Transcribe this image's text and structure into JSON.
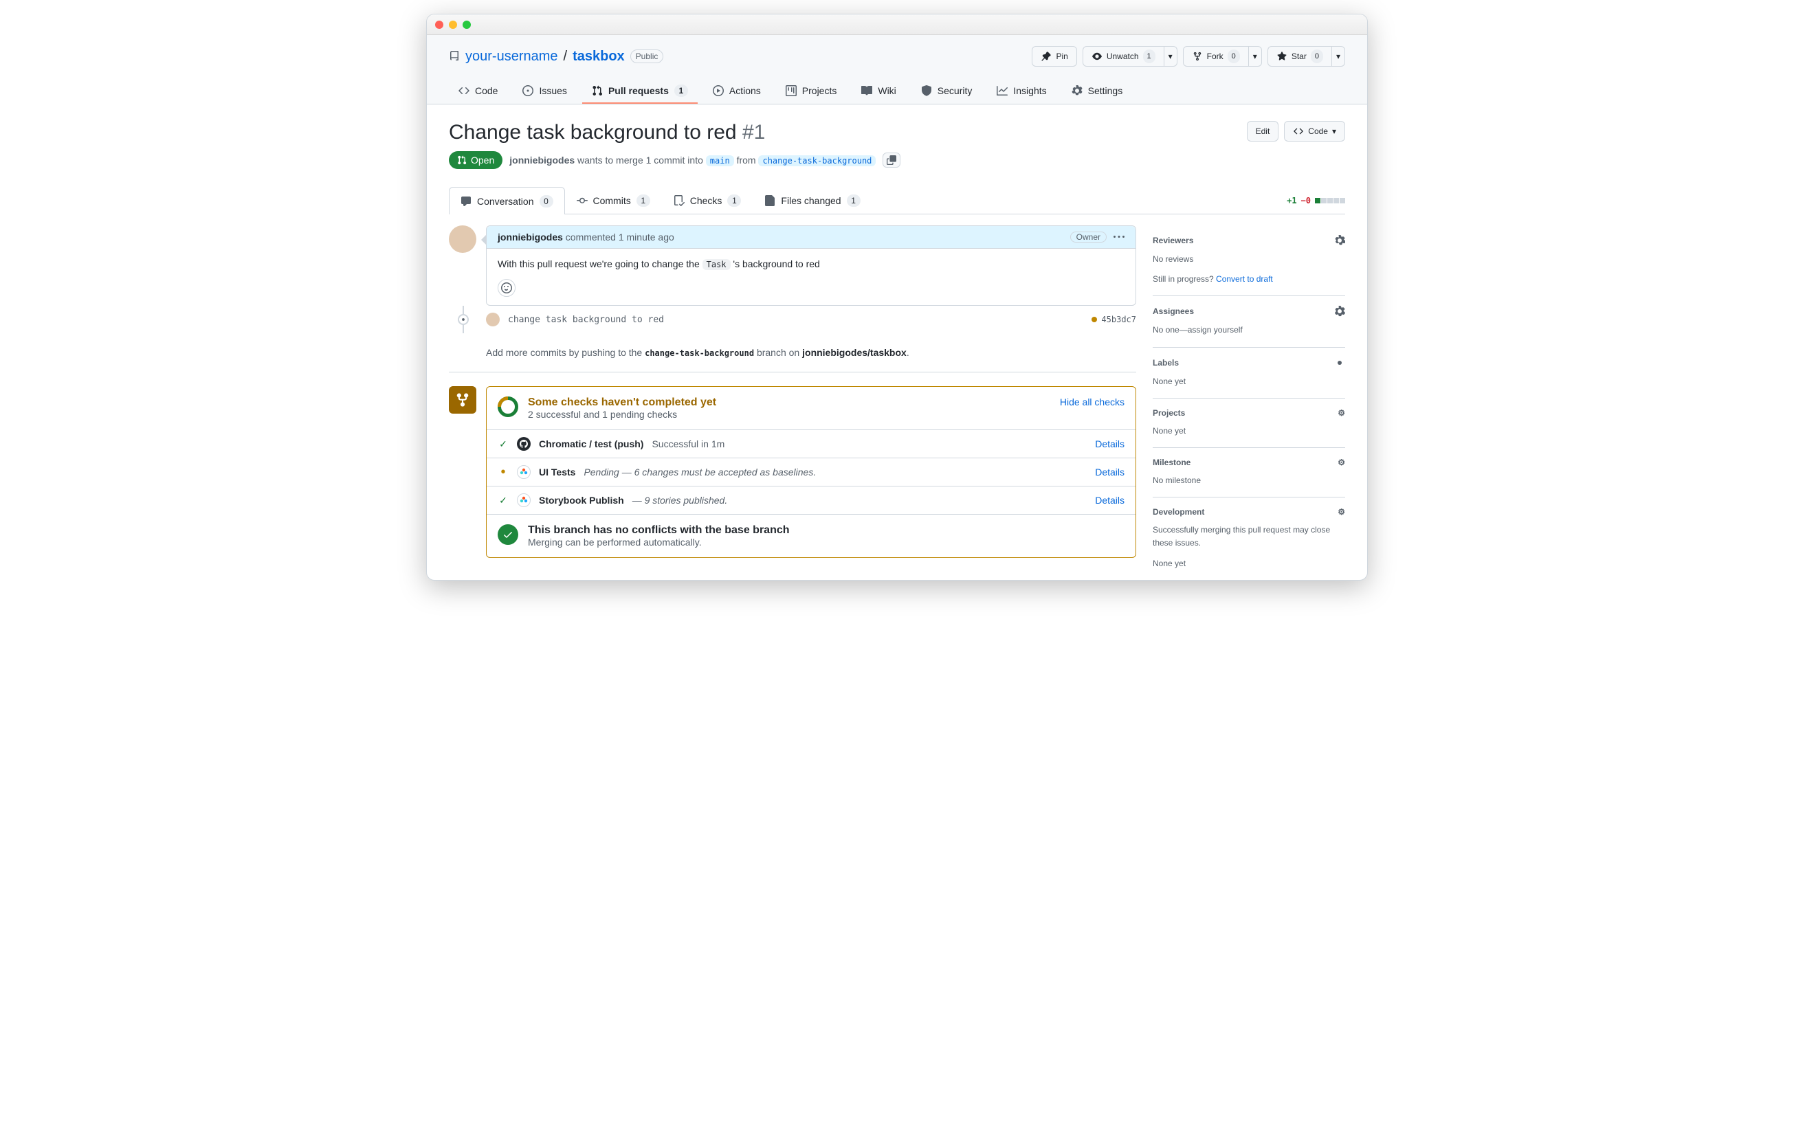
{
  "repo": {
    "owner": "your-username",
    "name": "taskbox",
    "visibility": "Public"
  },
  "header_actions": {
    "pin": "Pin",
    "unwatch": "Unwatch",
    "unwatch_count": "1",
    "fork": "Fork",
    "fork_count": "0",
    "star": "Star",
    "star_count": "0"
  },
  "nav": {
    "code": "Code",
    "issues": "Issues",
    "pulls": "Pull requests",
    "pulls_count": "1",
    "actions": "Actions",
    "projects": "Projects",
    "wiki": "Wiki",
    "security": "Security",
    "insights": "Insights",
    "settings": "Settings"
  },
  "pr": {
    "title": "Change task background to red",
    "number": "#1",
    "state": "Open",
    "author": "jonniebigodes",
    "wants_merge": " wants to merge 1 commit into ",
    "base": "main",
    "from_word": " from ",
    "head": "change-task-background",
    "edit_btn": "Edit",
    "code_btn": "Code"
  },
  "pr_tabs": {
    "conversation": "Conversation",
    "conversation_count": "0",
    "commits": "Commits",
    "commits_count": "1",
    "checks": "Checks",
    "checks_count": "1",
    "files": "Files changed",
    "files_count": "1",
    "diff_add": "+1",
    "diff_del": "−0"
  },
  "comment": {
    "author": "jonniebigodes",
    "action": " commented ",
    "time": "1 minute ago",
    "owner": "Owner",
    "body_pre": "With this pull request we're going to change the ",
    "body_code": "Task",
    "body_post": " 's background to red"
  },
  "commit": {
    "message": "change task background to red",
    "sha": "45b3dc7"
  },
  "push_hint": {
    "pre": "Add more commits by pushing to the ",
    "branch": "change-task-background",
    "mid": " branch on ",
    "repo": "jonniebigodes/taskbox",
    "post": "."
  },
  "checks": {
    "title": "Some checks haven't completed yet",
    "subtitle": "2 successful and 1 pending checks",
    "hide": "Hide all checks",
    "details": "Details",
    "rows": [
      {
        "name": "Chromatic / test (push)",
        "desc": "Successful in 1m",
        "status": "ok",
        "italic": false,
        "app": "gh"
      },
      {
        "name": "UI Tests",
        "desc": "Pending — 6 changes must be accepted as baselines.",
        "status": "pend",
        "italic": true,
        "app": "chr"
      },
      {
        "name": "Storybook Publish",
        "desc": "— 9 stories published.",
        "status": "ok",
        "italic": true,
        "app": "chr"
      }
    ],
    "merge_title": "This branch has no conflicts with the base branch",
    "merge_sub": "Merging can be performed automatically."
  },
  "sidebar": {
    "reviewers": {
      "title": "Reviewers",
      "body": "No reviews",
      "progress_q": "Still in progress? ",
      "draft": "Convert to draft"
    },
    "assignees": {
      "title": "Assignees",
      "body_pre": "No one—",
      "assign": "assign yourself"
    },
    "labels": {
      "title": "Labels",
      "body": "None yet"
    },
    "projects": {
      "title": "Projects",
      "body": "None yet"
    },
    "milestone": {
      "title": "Milestone",
      "body": "No milestone"
    },
    "development": {
      "title": "Development",
      "body": "Successfully merging this pull request may close these issues.",
      "none": "None yet"
    }
  }
}
